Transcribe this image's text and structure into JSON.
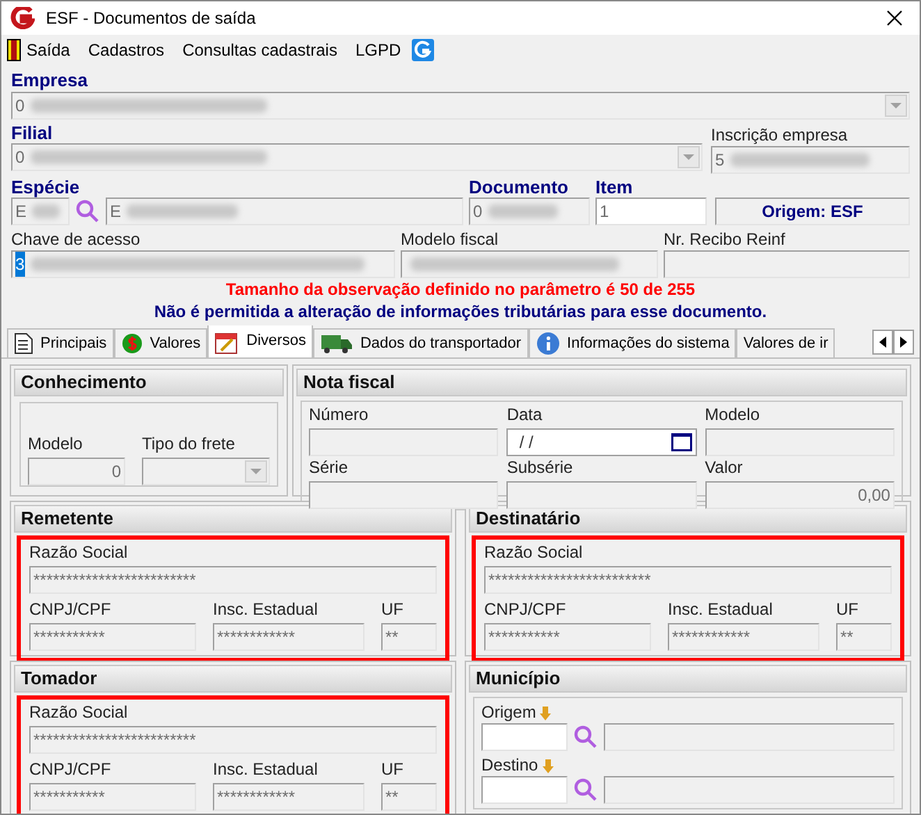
{
  "window": {
    "title": "ESF - Documentos de saída"
  },
  "menu": [
    {
      "label": "Saída"
    },
    {
      "label": "Cadastros"
    },
    {
      "label": "Consultas cadastrais"
    },
    {
      "label": "LGPD"
    }
  ],
  "empresa": {
    "label": "Empresa",
    "value": "0"
  },
  "filial": {
    "label": "Filial",
    "value": "0"
  },
  "inscricao": {
    "label": "Inscrição empresa",
    "value": "5"
  },
  "especie": {
    "label": "Espécie",
    "code": "E",
    "name": "E"
  },
  "documento": {
    "label": "Documento",
    "value": "0"
  },
  "item": {
    "label": "Item",
    "value": "1"
  },
  "origem": "Origem: ESF",
  "chave": {
    "label": "Chave de acesso",
    "value": "3",
    "selected": true
  },
  "modelo_fiscal": {
    "label": "Modelo fiscal"
  },
  "recibo": {
    "label": "Nr. Recibo Reinf"
  },
  "messages": [
    {
      "text": "Tamanho da observação definido no parâmetro é 50 de 255",
      "color": "#ff0000"
    },
    {
      "text": "Não é permitida a alteração de informações tributárias para esse documento.",
      "color": "#000080"
    }
  ],
  "tabs": [
    {
      "label": "Principais",
      "selected": false
    },
    {
      "label": "Valores",
      "selected": false
    },
    {
      "label": "Diversos",
      "selected": true
    },
    {
      "label": "Dados do transportador",
      "selected": false
    },
    {
      "label": "Informações do sistema",
      "selected": false
    },
    {
      "label": "Valores de ir",
      "selected": false
    }
  ],
  "conhecimento": {
    "title": "Conhecimento",
    "fields": [
      {
        "label": "Modelo",
        "value": "0",
        "kind": "number"
      },
      {
        "label": "Tipo do frete",
        "kind": "dropdown"
      }
    ]
  },
  "nota_fiscal": {
    "title": "Nota fiscal",
    "fields": [
      {
        "label": "Número",
        "kind": "text"
      },
      {
        "label": "Data",
        "value": " /  /",
        "kind": "date"
      },
      {
        "label": "Modelo",
        "kind": "text"
      },
      {
        "label": "Série",
        "kind": "text"
      },
      {
        "label": "Subsérie",
        "kind": "text"
      },
      {
        "label": "Valor",
        "value": "0,00",
        "kind": "number"
      }
    ]
  },
  "parties": [
    {
      "title": "Remetente",
      "highlighted": true,
      "fields": [
        {
          "label": "Razão Social",
          "value": "*************************"
        },
        {
          "label": "CNPJ/CPF",
          "value": "***********"
        },
        {
          "label": "Insc. Estadual",
          "value": "************"
        },
        {
          "label": "UF",
          "value": "**"
        }
      ]
    },
    {
      "title": "Destinatário",
      "highlighted": true,
      "fields": [
        {
          "label": "Razão Social",
          "value": "*************************"
        },
        {
          "label": "CNPJ/CPF",
          "value": "***********"
        },
        {
          "label": "Insc. Estadual",
          "value": "************"
        },
        {
          "label": "UF",
          "value": "**"
        }
      ]
    },
    {
      "title": "Tomador",
      "highlighted": true,
      "fields": [
        {
          "label": "Razão Social",
          "value": "*************************"
        },
        {
          "label": "CNPJ/CPF",
          "value": "***********"
        },
        {
          "label": "Insc. Estadual",
          "value": "************"
        },
        {
          "label": "UF",
          "value": "**"
        }
      ]
    }
  ],
  "municipio": {
    "title": "Município",
    "fields": [
      {
        "label": "Origem"
      },
      {
        "label": "Destino"
      }
    ]
  }
}
